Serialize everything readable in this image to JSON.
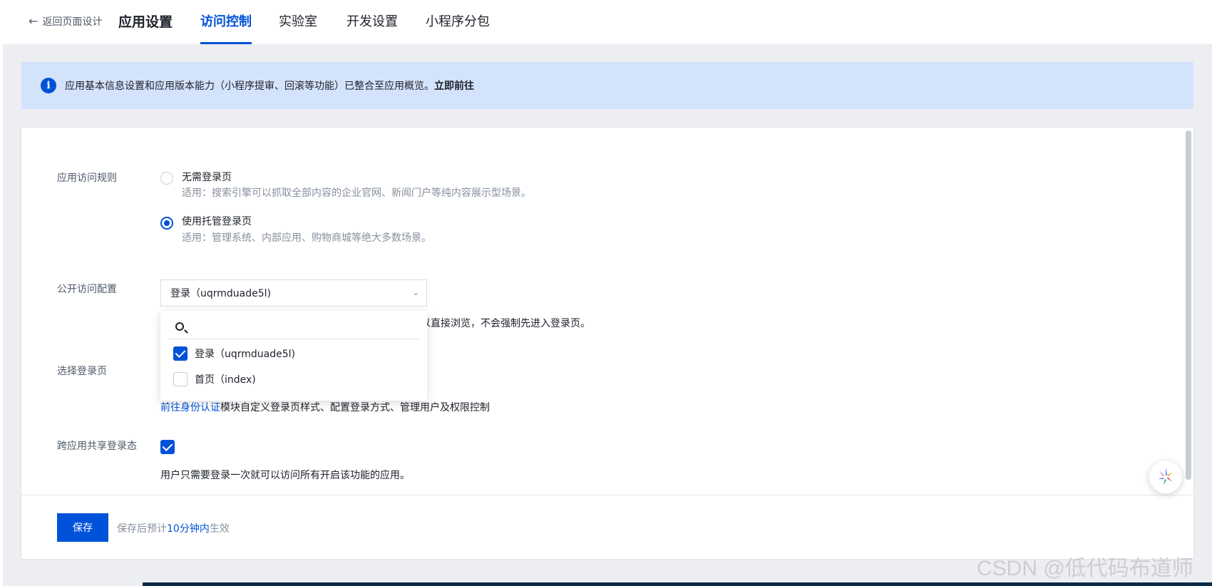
{
  "nav": {
    "back_label": "返回页面设计",
    "tabs": [
      {
        "label": "应用设置"
      },
      {
        "label": "访问控制"
      },
      {
        "label": "实验室"
      },
      {
        "label": "开发设置"
      },
      {
        "label": "小程序分包"
      }
    ],
    "active_tab": "访问控制"
  },
  "banner": {
    "message": "应用基本信息设置和应用版本能力（小程序提审、回滚等功能）已整合至应用概览。",
    "link": "立即前往"
  },
  "form": {
    "access_rule": {
      "label": "应用访问规则",
      "options": [
        {
          "title": "无需登录页",
          "desc": "适用：搜索引擎可以抓取全部内容的企业官网、新闻门户等纯内容展示型场景。",
          "selected": false
        },
        {
          "title": "使用托管登录页",
          "desc": "适用：管理系统、内部应用、购物商城等绝大多数场景。",
          "selected": true
        }
      ]
    },
    "public_access": {
      "label": "公开访问配置",
      "selected_value": "登录（uqrmduade5l)",
      "hint_visible": "以直接浏览，不会强制先进入登录页。",
      "dropdown": {
        "search_placeholder": "",
        "items": [
          {
            "label": "登录（uqrmduade5l)",
            "checked": true
          },
          {
            "label": "首页（index)",
            "checked": false
          }
        ]
      }
    },
    "login_page": {
      "label": "选择登录页",
      "link": "前往身份认证",
      "link_suffix": "模块自定义登录页样式、配置登录方式、管理用户及权限控制"
    },
    "shared_login": {
      "label": "跨应用共享登录态",
      "checked": true,
      "desc": "用户只需要登录一次就可以访问所有开启该功能的应用。"
    }
  },
  "footer": {
    "save_label": "保存",
    "hint_prefix": "保存后预计",
    "hint_highlight": "10分钟内",
    "hint_suffix": "生效"
  },
  "watermark": "CSDN @低代码布道师",
  "colors": {
    "accent": "#0052d9",
    "banner_bg": "#d4e3fc",
    "page_bg": "#eceef2"
  }
}
